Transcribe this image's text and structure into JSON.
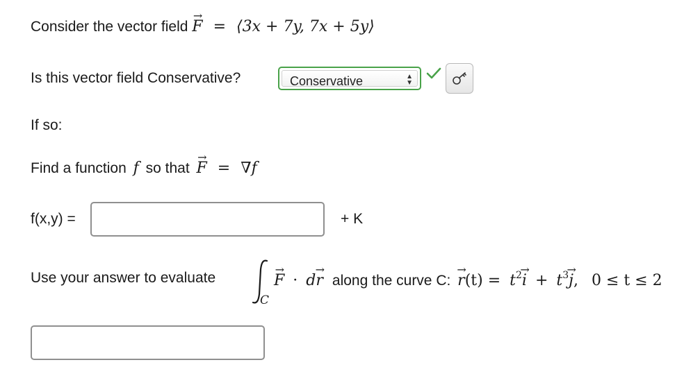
{
  "q1": {
    "prefix": "Consider the vector field",
    "F": "F",
    "eq": "=",
    "field": "⟨3x + 7y, 7x + 5y⟩"
  },
  "q2": {
    "label": "Is this vector field Conservative?",
    "select_value": "Conservative",
    "status": "correct",
    "status_color": "#49a249",
    "key_icon": "key-icon"
  },
  "q3": {
    "label": "If so:"
  },
  "q4": {
    "prefix": "Find a function",
    "f": "f",
    "middle": "so that",
    "F": "F",
    "eq": "=",
    "grad": "∇",
    "f2": "f"
  },
  "q5": {
    "label": "f(x,y) =",
    "value": "",
    "suffix": "+ K"
  },
  "q6": {
    "prefix": "Use your answer to evaluate",
    "integral_sub": "C",
    "F": "F",
    "dot": "·",
    "d": "d",
    "r": "r",
    "middle": "along the curve C:",
    "r2": "r",
    "t_paren": "(t) =",
    "t1": "t",
    "exp1": "2",
    "i": "i",
    "plus": "+",
    "t2": "t",
    "exp2": "3",
    "j": "j",
    "comma": ",",
    "range": "0 ≤ t ≤ 2"
  },
  "answer": {
    "value": ""
  }
}
